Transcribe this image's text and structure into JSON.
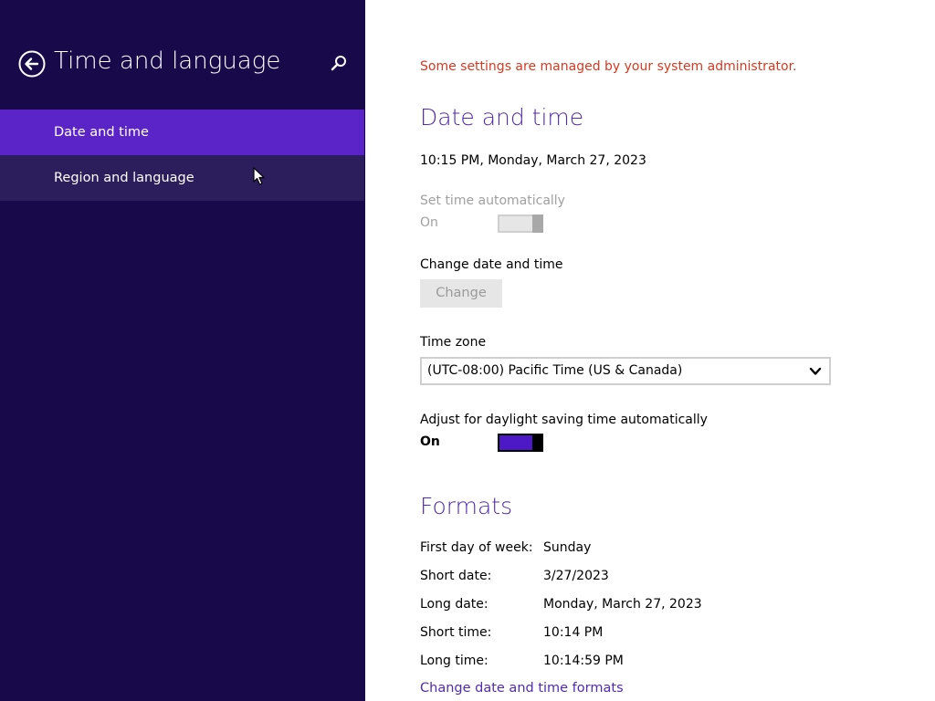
{
  "sidebar": {
    "title": "Time and language",
    "items": [
      {
        "label": "Date and time"
      },
      {
        "label": "Region and language"
      }
    ]
  },
  "main": {
    "admin_notice": "Some settings are managed by your system administrator.",
    "date_time": {
      "heading": "Date and time",
      "current": "10:15 PM, Monday, March 27, 2023",
      "set_auto_label": "Set time automatically",
      "set_auto_state": "On",
      "change_label": "Change date and time",
      "change_button": "Change",
      "timezone_label": "Time zone",
      "timezone_value": "(UTC-08:00) Pacific Time (US & Canada)",
      "dst_label": "Adjust for daylight saving time automatically",
      "dst_state": "On"
    },
    "formats": {
      "heading": "Formats",
      "rows": [
        {
          "label": "First day of week:",
          "value": "Sunday"
        },
        {
          "label": "Short date:",
          "value": "3/27/2023"
        },
        {
          "label": "Long date:",
          "value": "Monday, March 27, 2023"
        },
        {
          "label": "Short time:",
          "value": "10:14 PM"
        },
        {
          "label": "Long time:",
          "value": "10:14:59 PM"
        }
      ],
      "link": "Change date and time formats"
    }
  },
  "icons": {
    "back": "back-arrow-icon",
    "search": "search-icon",
    "dropdown": "chevron-down-icon",
    "cursor": "mouse-pointer-icon"
  },
  "colors": {
    "sidebar_bg": "#180a4a",
    "nav_active": "#5a24c8",
    "nav_hover": "#2c1e5d",
    "accent": "#4f2bb0",
    "warning": "#d9381e",
    "toggle_on": "#4d19c6"
  }
}
